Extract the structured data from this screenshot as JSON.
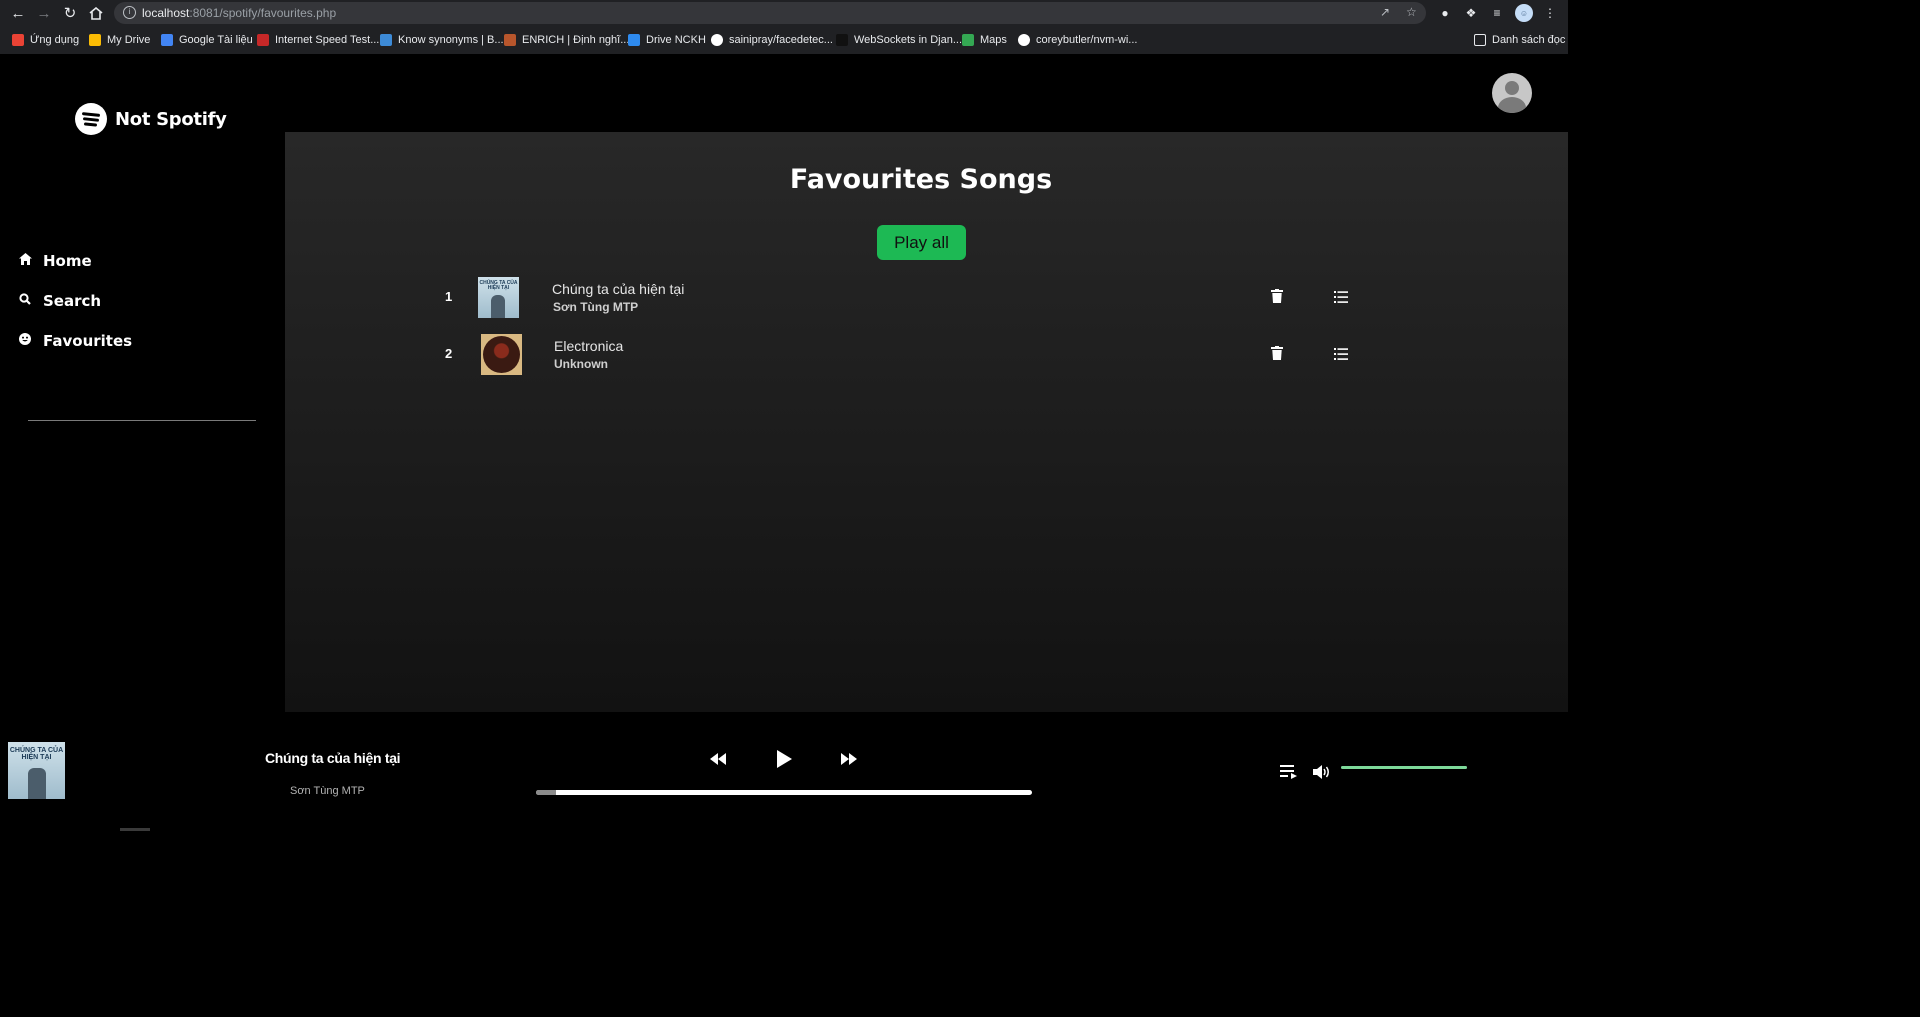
{
  "browser": {
    "url_host": "localhost",
    "url_rest": ":8081/spotify/favourites.php",
    "bookmarks": [
      {
        "label": "Ứng dụng",
        "color": "#ea4335"
      },
      {
        "label": "My Drive",
        "color": "#fbbc04"
      },
      {
        "label": "Google Tài liệu",
        "color": "#4285f4"
      },
      {
        "label": "Internet Speed Test...",
        "color": "#c62828"
      },
      {
        "label": "Know synonyms | B...",
        "color": "#3d8bd8"
      },
      {
        "label": "ENRICH | Định nghĩ...",
        "color": "#b8562c"
      },
      {
        "label": "Drive NCKH",
        "color": "#2e8bf0"
      },
      {
        "label": "sainipray/facedetec...",
        "color": "#ffffff"
      },
      {
        "label": "WebSockets in Djan...",
        "color": "#111111"
      },
      {
        "label": "Maps",
        "color": "#34a853"
      },
      {
        "label": "coreybutler/nvm-wi...",
        "color": "#ffffff"
      }
    ],
    "reading_list": "Danh sách đọc"
  },
  "app": {
    "brand": "Not Spotify",
    "nav": [
      {
        "label": "Home",
        "icon": "home-icon"
      },
      {
        "label": "Search",
        "icon": "search-icon"
      },
      {
        "label": "Favourites",
        "icon": "smile-icon"
      }
    ],
    "page_title": "Favourites Songs",
    "play_all_label": "Play all",
    "songs": [
      {
        "index": "1",
        "title": "Chúng ta của hiện tại",
        "artist": "Sơn Tùng MTP",
        "cover_text": "CHÚNG TA CỦA HIỆN TẠI"
      },
      {
        "index": "2",
        "title": "Electronica",
        "artist": "Unknown"
      }
    ]
  },
  "player": {
    "title": "Chúng ta của hiện tại",
    "artist": "Sơn Tùng MTP",
    "cover_text": "CHÚNG TA CỦA HIỆN TẠI",
    "progress_fraction": 0.04,
    "volume_fraction": 1.0,
    "accent_color": "#1db954"
  }
}
